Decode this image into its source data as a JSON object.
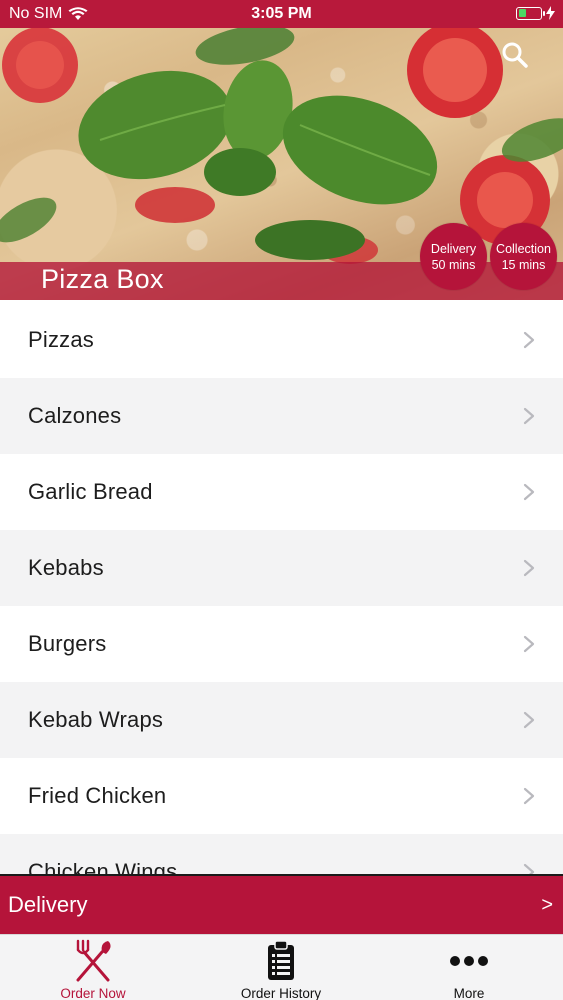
{
  "status_bar": {
    "carrier": "No SIM",
    "time": "3:05 PM",
    "battery_level": 0.35
  },
  "header": {
    "shop_name": "Pizza Box",
    "search_icon": "search-icon",
    "badges": {
      "delivery": {
        "title": "Delivery",
        "time": "50 mins"
      },
      "collection": {
        "title": "Collection",
        "time": "15 mins"
      }
    }
  },
  "menu": {
    "categories": [
      {
        "label": "Pizzas"
      },
      {
        "label": "Calzones"
      },
      {
        "label": "Garlic Bread"
      },
      {
        "label": "Kebabs"
      },
      {
        "label": "Burgers"
      },
      {
        "label": "Kebab Wraps"
      },
      {
        "label": "Fried Chicken"
      },
      {
        "label": "Chicken Wings"
      }
    ],
    "row_icon": "chevron-right-icon"
  },
  "delivery_bar": {
    "label": "Delivery",
    "arrow": ">"
  },
  "tab_bar": {
    "tabs": [
      {
        "label": "Order Now",
        "icon": "fork-knife-icon",
        "active": true
      },
      {
        "label": "Order History",
        "icon": "clipboard-list-icon",
        "active": false
      },
      {
        "label": "More",
        "icon": "more-dots-icon",
        "active": false
      }
    ]
  },
  "colors": {
    "brand": "#b5143a",
    "list_alt_row": "#f3f3f4",
    "tab_bar_bg": "#f4f4f5"
  }
}
